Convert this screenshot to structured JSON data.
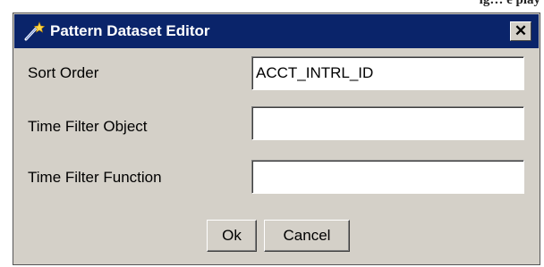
{
  "background": {
    "fragment_text": "ig… e play"
  },
  "dialog": {
    "title": "Pattern Dataset Editor",
    "close_glyph": "✕",
    "colors": {
      "titlebar": "#0a246a",
      "face": "#d4d0c8"
    },
    "fields": [
      {
        "label": "Sort Order",
        "value": "ACCT_INTRL_ID"
      },
      {
        "label": "Time Filter Object",
        "value": ""
      },
      {
        "label": "Time Filter Function",
        "value": ""
      }
    ],
    "buttons": {
      "ok": "Ok",
      "cancel": "Cancel"
    }
  }
}
